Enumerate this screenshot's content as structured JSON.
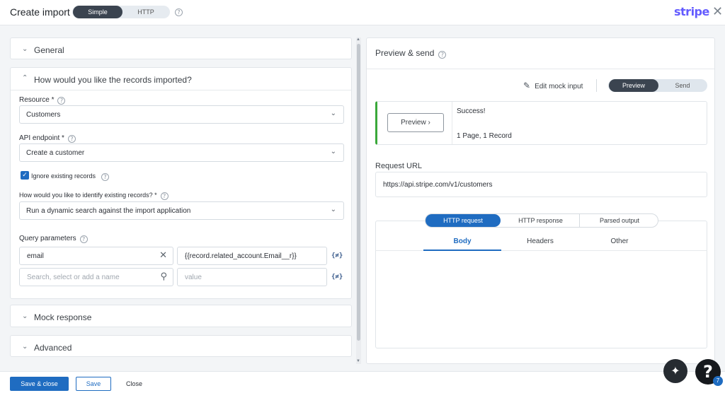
{
  "header": {
    "title": "Create import",
    "mode_options": [
      "Simple",
      "HTTP"
    ],
    "help_glyph": "?",
    "brand": "stripe",
    "close_glyph": "✕"
  },
  "left": {
    "general": {
      "label": "General"
    },
    "records": {
      "label": "How would you like the records imported?",
      "resource": {
        "label": "Resource *",
        "value": "Customers"
      },
      "endpoint": {
        "label": "API endpoint *",
        "value": "Create a customer"
      },
      "ignore_existing": {
        "label": "Ignore existing records",
        "checked": true
      },
      "identify": {
        "label": "How would you like to identify existing records? *",
        "value": "Run a dynamic search against the import application"
      },
      "query_params": {
        "label": "Query parameters",
        "rows": [
          {
            "name": "email",
            "value": "{{record.related_account.Email__r}}"
          },
          {
            "name_placeholder": "Search, select or add a name",
            "value_placeholder": "value"
          }
        ]
      }
    },
    "mock_response": {
      "label": "Mock response"
    },
    "advanced": {
      "label": "Advanced"
    }
  },
  "right": {
    "title": "Preview & send",
    "edit_mock": "Edit mock input",
    "toggle": [
      "Preview",
      "Send"
    ],
    "status": {
      "preview_button": "Preview",
      "message": "Success!",
      "summary": "1 Page, 1 Record"
    },
    "request_url_label": "Request URL",
    "request_url": "https://api.stripe.com/v1/customers",
    "http_tabs": [
      "HTTP request",
      "HTTP response",
      "Parsed output"
    ],
    "sub_tabs": [
      "Body",
      "Headers",
      "Other"
    ]
  },
  "footer": {
    "save_close": "Save & close",
    "save": "Save",
    "close": "Close"
  },
  "fab": {
    "help_glyph": "?",
    "badge": "7",
    "ai_glyph": "✦"
  },
  "colors": {
    "primary": "#1f6cc1",
    "brand": "#635bff",
    "success": "#3aa83a"
  }
}
